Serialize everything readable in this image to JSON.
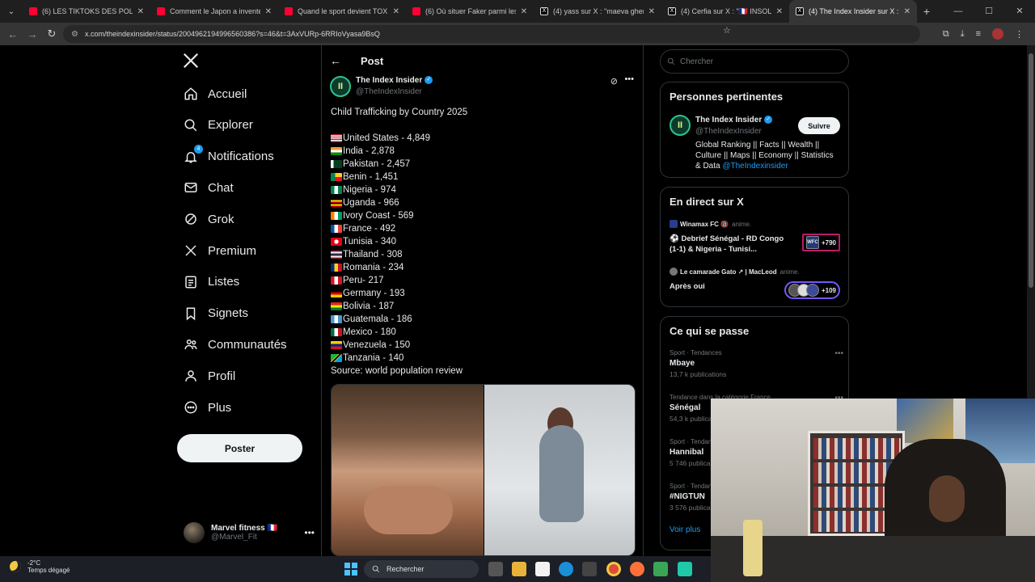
{
  "browser": {
    "tabs": [
      {
        "title": "(6) LES TIKTOKS DES POLITIQUES",
        "favicon": "youtube-icon"
      },
      {
        "title": "Comment le Japon a inventé l'a",
        "favicon": "youtube-icon"
      },
      {
        "title": "Quand le sport devient TOXIQU",
        "favicon": "youtube-icon"
      },
      {
        "title": "(6) Où situer Faker parmi les lé",
        "favicon": "youtube-icon"
      },
      {
        "title": "(4) yass sur X : \"maeva ghennam",
        "favicon": "x-icon"
      },
      {
        "title": "(4) Cerfia sur X : \"🇫🇷 INSOLITE |",
        "favicon": "x-icon"
      },
      {
        "title": "(4) The Index Insider sur X : \"Ch",
        "favicon": "x-icon",
        "active": true
      }
    ],
    "url": "x.com/theindexinsider/status/2004962194996560386?s=46&t=3AxVURp-6RRIoVyasa9BsQ"
  },
  "nav": {
    "items": [
      {
        "label": "Accueil",
        "icon": "home-icon"
      },
      {
        "label": "Explorer",
        "icon": "search-icon"
      },
      {
        "label": "Notifications",
        "icon": "bell-icon",
        "badge": "4"
      },
      {
        "label": "Chat",
        "icon": "mail-icon"
      },
      {
        "label": "Grok",
        "icon": "grok-icon"
      },
      {
        "label": "Premium",
        "icon": "x-icon"
      },
      {
        "label": "Listes",
        "icon": "list-icon"
      },
      {
        "label": "Signets",
        "icon": "bookmark-icon"
      },
      {
        "label": "Communautés",
        "icon": "communities-icon"
      },
      {
        "label": "Profil",
        "icon": "profile-icon"
      },
      {
        "label": "Plus",
        "icon": "more-circle-icon"
      }
    ],
    "post_button": "Poster",
    "account": {
      "name": "Marvel fitness 🇫🇷",
      "handle": "@Marvel_Fit"
    }
  },
  "post": {
    "header": "Post",
    "author_name": "The Index Insider",
    "author_handle": "@TheIndexInsider",
    "title": "Child Trafficking by Country 2025",
    "rows": [
      {
        "text": "United States - 4,849",
        "flag": "us"
      },
      {
        "text": "India - 2,878",
        "flag": "in"
      },
      {
        "text": "Pakistan - 2,457",
        "flag": "pk"
      },
      {
        "text": "Benin - 1,451",
        "flag": "bj"
      },
      {
        "text": "Nigeria - 974",
        "flag": "ng"
      },
      {
        "text": "Uganda - 966",
        "flag": "ug"
      },
      {
        "text": "Ivory Coast - 569",
        "flag": "ci"
      },
      {
        "text": "France - 492",
        "flag": "fr"
      },
      {
        "text": "Tunisia - 340",
        "flag": "tn"
      },
      {
        "text": "Thailand - 308",
        "flag": "th"
      },
      {
        "text": "Romania - 234",
        "flag": "ro"
      },
      {
        "text": "Peru- 217",
        "flag": "pe"
      },
      {
        "text": "Germany - 193",
        "flag": "de"
      },
      {
        "text": "Bolivia - 187",
        "flag": "bo"
      },
      {
        "text": "Guatemala - 186",
        "flag": "gt"
      },
      {
        "text": "Mexico - 180",
        "flag": "mx"
      },
      {
        "text": "Venezuela - 150",
        "flag": "ve"
      },
      {
        "text": "Tanzania - 140",
        "flag": "tz"
      }
    ],
    "source": "Source: world population review"
  },
  "right": {
    "search_placeholder": "Chercher",
    "relevant": {
      "title": "Personnes pertinentes",
      "name": "The Index Insider",
      "handle": "@TheIndexInsider",
      "follow": "Suivre",
      "bio": "Global Ranking || Facts || Wealth || Culture || Maps || Economy || Statistics & Data ",
      "bio_link": "@TheIndexinsider"
    },
    "live": {
      "title": "En direct sur X",
      "items": [
        {
          "host": "Winamax FC 🔞",
          "status": "anime.",
          "title": "⚽ Debrief Sénégal - RD Congo (1-1) & Nigeria - Tunisi...",
          "count": "+790",
          "badge_text": "WFC"
        },
        {
          "host": "Le camarade Gato ↗ | MacLeod",
          "status": "anime.",
          "title": "Après oui",
          "count": "+109",
          "badge_text": ""
        }
      ]
    },
    "trends": {
      "title": "Ce qui se passe",
      "items": [
        {
          "category": "Sport · Tendances",
          "name": "Mbaye",
          "count": "13,7 k publications"
        },
        {
          "category": "Tendance dans la catégorie France",
          "name": "Sénégal",
          "count": "54,3 k publications"
        },
        {
          "category": "Sport · Tendances",
          "name": "Hannibal",
          "count": "5 746 publications"
        },
        {
          "category": "Sport · Tendances",
          "name": "#NIGTUN",
          "count": "3 576 publications"
        }
      ],
      "see_more": "Voir plus"
    }
  },
  "taskbar": {
    "temp": "-2°C",
    "weather": "Temps dégagé",
    "search": "Rechercher"
  },
  "colors": {
    "accent": "#1d9bf0",
    "background": "#000000",
    "border": "#2f3336"
  }
}
